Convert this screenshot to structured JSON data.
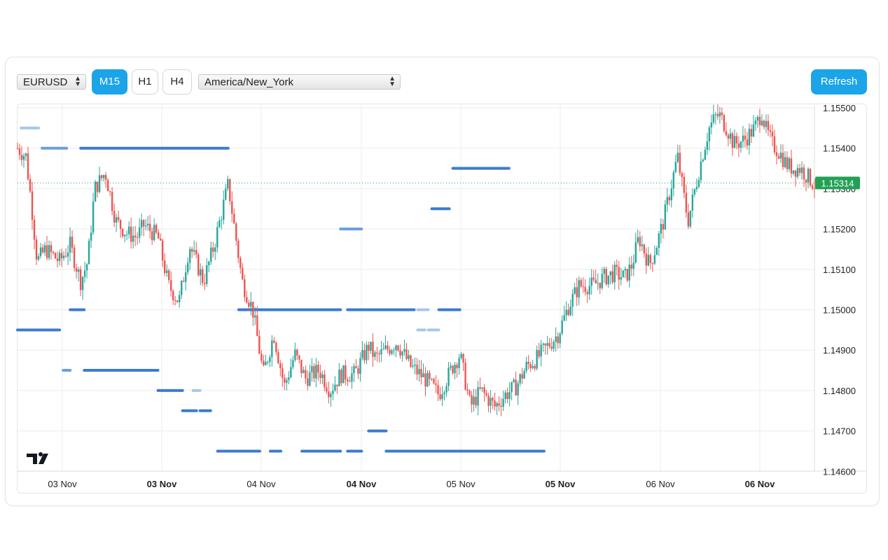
{
  "toolbar": {
    "symbol": "EURUSD",
    "timeframes": [
      {
        "label": "M15",
        "active": true
      },
      {
        "label": "H1",
        "active": false
      },
      {
        "label": "H4",
        "active": false
      }
    ],
    "timezone": "America/New_York",
    "refresh_label": "Refresh"
  },
  "colors": {
    "accent": "#1ba4e8",
    "up": "#26a69a",
    "down": "#ef5350",
    "level_dark": "#3b7bd0",
    "level_light": "#a8c7ec",
    "price_tag": "#22a154"
  },
  "logo": "TV",
  "chart_data": {
    "type": "candlestick",
    "title": "",
    "xlabel": "",
    "ylabel": "",
    "ylim": [
      1.146,
      1.1555
    ],
    "y_ticks": [
      "1.15500",
      "1.15400",
      "1.15300",
      "1.15200",
      "1.15100",
      "1.15000",
      "1.14900",
      "1.14800",
      "1.14700",
      "1.14600"
    ],
    "x_ticks": [
      {
        "label": "03 Nov",
        "bold": false
      },
      {
        "label": "03 Nov",
        "bold": true
      },
      {
        "label": "04 Nov",
        "bold": false
      },
      {
        "label": "04 Nov",
        "bold": true
      },
      {
        "label": "05 Nov",
        "bold": false
      },
      {
        "label": "05 Nov",
        "bold": true
      },
      {
        "label": "06 Nov",
        "bold": false
      },
      {
        "label": "06 Nov",
        "bold": true
      }
    ],
    "last_price": "1.15314",
    "price_path": [
      [
        0.0,
        1.154
      ],
      [
        0.012,
        1.1538
      ],
      [
        0.02,
        1.1526
      ],
      [
        0.028,
        1.1512
      ],
      [
        0.04,
        1.1515
      ],
      [
        0.06,
        1.1512
      ],
      [
        0.075,
        1.1516
      ],
      [
        0.09,
        1.1507
      ],
      [
        0.1,
        1.1512
      ],
      [
        0.11,
        1.153
      ],
      [
        0.125,
        1.1534
      ],
      [
        0.14,
        1.1522
      ],
      [
        0.155,
        1.1519
      ],
      [
        0.17,
        1.1518
      ],
      [
        0.18,
        1.1521
      ],
      [
        0.2,
        1.1518
      ],
      [
        0.215,
        1.1506
      ],
      [
        0.23,
        1.1502
      ],
      [
        0.245,
        1.1516
      ],
      [
        0.265,
        1.1507
      ],
      [
        0.28,
        1.1516
      ],
      [
        0.3,
        1.1531
      ],
      [
        0.31,
        1.1519
      ],
      [
        0.32,
        1.1507
      ],
      [
        0.335,
        1.15
      ],
      [
        0.35,
        1.1484
      ],
      [
        0.365,
        1.1494
      ],
      [
        0.38,
        1.1481
      ],
      [
        0.395,
        1.1489
      ],
      [
        0.41,
        1.1483
      ],
      [
        0.43,
        1.1485
      ],
      [
        0.445,
        1.148
      ],
      [
        0.46,
        1.1484
      ],
      [
        0.48,
        1.1484
      ],
      [
        0.5,
        1.1491
      ],
      [
        0.51,
        1.1488
      ],
      [
        0.525,
        1.149
      ],
      [
        0.54,
        1.1492
      ],
      [
        0.56,
        1.1486
      ],
      [
        0.58,
        1.1483
      ],
      [
        0.6,
        1.1479
      ],
      [
        0.62,
        1.1486
      ],
      [
        0.63,
        1.1489
      ],
      [
        0.645,
        1.1476
      ],
      [
        0.66,
        1.148
      ],
      [
        0.68,
        1.1476
      ],
      [
        0.695,
        1.1479
      ],
      [
        0.71,
        1.1481
      ],
      [
        0.725,
        1.1486
      ],
      [
        0.74,
        1.1488
      ],
      [
        0.755,
        1.1491
      ],
      [
        0.77,
        1.1494
      ],
      [
        0.785,
        1.1501
      ],
      [
        0.8,
        1.1506
      ],
      [
        0.82,
        1.1506
      ],
      [
        0.835,
        1.1508
      ],
      [
        0.85,
        1.1509
      ],
      [
        0.865,
        1.1508
      ],
      [
        0.875,
        1.1511
      ],
      [
        0.885,
        1.1518
      ],
      [
        0.9,
        1.1511
      ],
      [
        0.91,
        1.1516
      ],
      [
        0.92,
        1.1522
      ],
      [
        0.93,
        1.153
      ],
      [
        0.94,
        1.1538
      ],
      [
        0.95,
        1.1527
      ],
      [
        0.955,
        1.1522
      ],
      [
        0.965,
        1.153
      ],
      [
        0.975,
        1.1538
      ],
      [
        0.985,
        1.1545
      ],
      [
        0.995,
        1.1548
      ],
      [
        1.0,
        1.1548
      ],
      [
        1.01,
        1.1545
      ],
      [
        1.02,
        1.1541
      ],
      [
        1.035,
        1.1542
      ],
      [
        1.05,
        1.1545
      ],
      [
        1.06,
        1.1549
      ],
      [
        1.065,
        1.1545
      ],
      [
        1.075,
        1.1541
      ],
      [
        1.085,
        1.1539
      ],
      [
        1.095,
        1.1536
      ],
      [
        1.105,
        1.1535
      ],
      [
        1.115,
        1.1535
      ],
      [
        1.125,
        1.1533
      ],
      [
        1.135,
        1.1531
      ]
    ],
    "levels": [
      {
        "price": 1.1545,
        "x_from": 0.005,
        "x_to": 0.03,
        "style": "light"
      },
      {
        "price": 1.154,
        "x_from": 0.035,
        "x_to": 0.07,
        "style": "mid"
      },
      {
        "price": 1.154,
        "x_from": 0.09,
        "x_to": 0.3,
        "style": "dark"
      },
      {
        "price": 1.1535,
        "x_from": 0.62,
        "x_to": 0.7,
        "style": "dark"
      },
      {
        "price": 1.1525,
        "x_from": 0.59,
        "x_to": 0.615,
        "style": "dark"
      },
      {
        "price": 1.152,
        "x_from": 0.46,
        "x_to": 0.49,
        "style": "mid"
      },
      {
        "price": 1.15,
        "x_from": 0.075,
        "x_to": 0.095,
        "style": "dark"
      },
      {
        "price": 1.15,
        "x_from": 0.315,
        "x_to": 0.46,
        "style": "dark"
      },
      {
        "price": 1.15,
        "x_from": 0.47,
        "x_to": 0.565,
        "style": "dark"
      },
      {
        "price": 1.15,
        "x_from": 0.57,
        "x_to": 0.585,
        "style": "light"
      },
      {
        "price": 1.15,
        "x_from": 0.6,
        "x_to": 0.63,
        "style": "dark"
      },
      {
        "price": 1.1495,
        "x_from": 0.0,
        "x_to": 0.06,
        "style": "dark"
      },
      {
        "price": 1.1495,
        "x_from": 0.57,
        "x_to": 0.58,
        "style": "light"
      },
      {
        "price": 1.1495,
        "x_from": 0.585,
        "x_to": 0.6,
        "style": "light"
      },
      {
        "price": 1.1485,
        "x_from": 0.065,
        "x_to": 0.075,
        "style": "mid"
      },
      {
        "price": 1.1485,
        "x_from": 0.095,
        "x_to": 0.2,
        "style": "dark"
      },
      {
        "price": 1.148,
        "x_from": 0.2,
        "x_to": 0.235,
        "style": "dark"
      },
      {
        "price": 1.148,
        "x_from": 0.25,
        "x_to": 0.26,
        "style": "light"
      },
      {
        "price": 1.1475,
        "x_from": 0.235,
        "x_to": 0.255,
        "style": "dark"
      },
      {
        "price": 1.1475,
        "x_from": 0.26,
        "x_to": 0.275,
        "style": "dark"
      },
      {
        "price": 1.147,
        "x_from": 0.5,
        "x_to": 0.525,
        "style": "dark"
      },
      {
        "price": 1.1465,
        "x_from": 0.285,
        "x_to": 0.345,
        "style": "dark"
      },
      {
        "price": 1.1465,
        "x_from": 0.36,
        "x_to": 0.375,
        "style": "dark"
      },
      {
        "price": 1.1465,
        "x_from": 0.405,
        "x_to": 0.46,
        "style": "dark"
      },
      {
        "price": 1.1465,
        "x_from": 0.47,
        "x_to": 0.49,
        "style": "dark"
      },
      {
        "price": 1.1465,
        "x_from": 0.525,
        "x_to": 0.75,
        "style": "dark"
      }
    ]
  }
}
